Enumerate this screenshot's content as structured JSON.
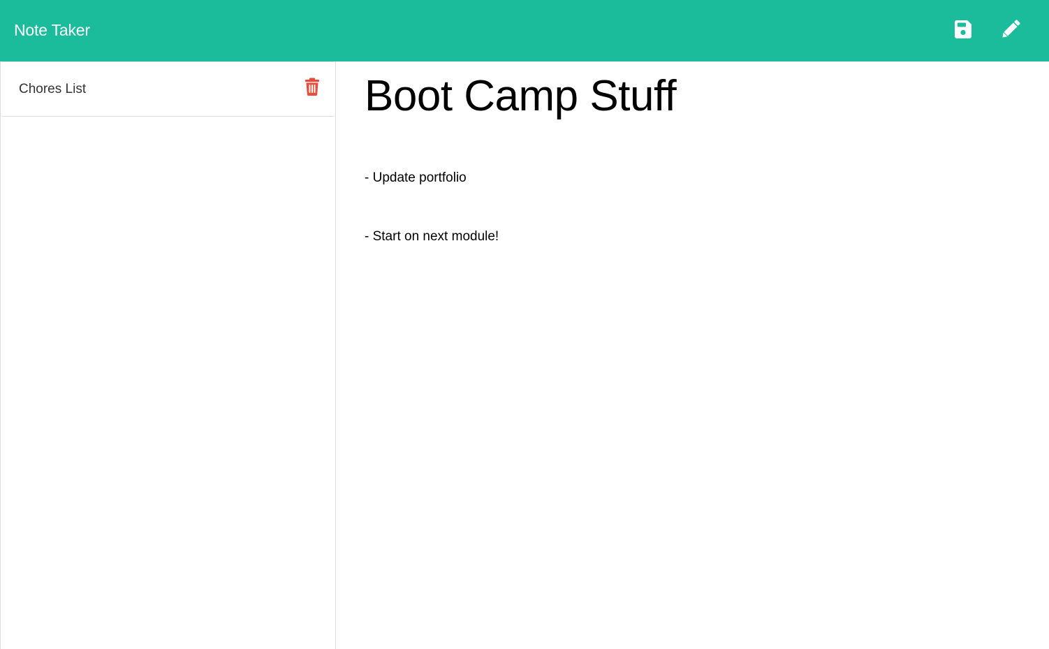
{
  "app": {
    "title": "Note Taker"
  },
  "header": {
    "save_icon": "floppy-disk-icon",
    "new_icon": "pencil-icon"
  },
  "sidebar": {
    "items": [
      {
        "title": "Chores List",
        "delete_icon": "trash-icon"
      }
    ]
  },
  "editor": {
    "title": "Boot Camp Stuff",
    "body_lines": [
      "- Update portfolio",
      "- Start on next module!"
    ]
  },
  "colors": {
    "header_bg": "#1abc9c",
    "delete": "#e74c3c",
    "icon": "#ffffff"
  }
}
